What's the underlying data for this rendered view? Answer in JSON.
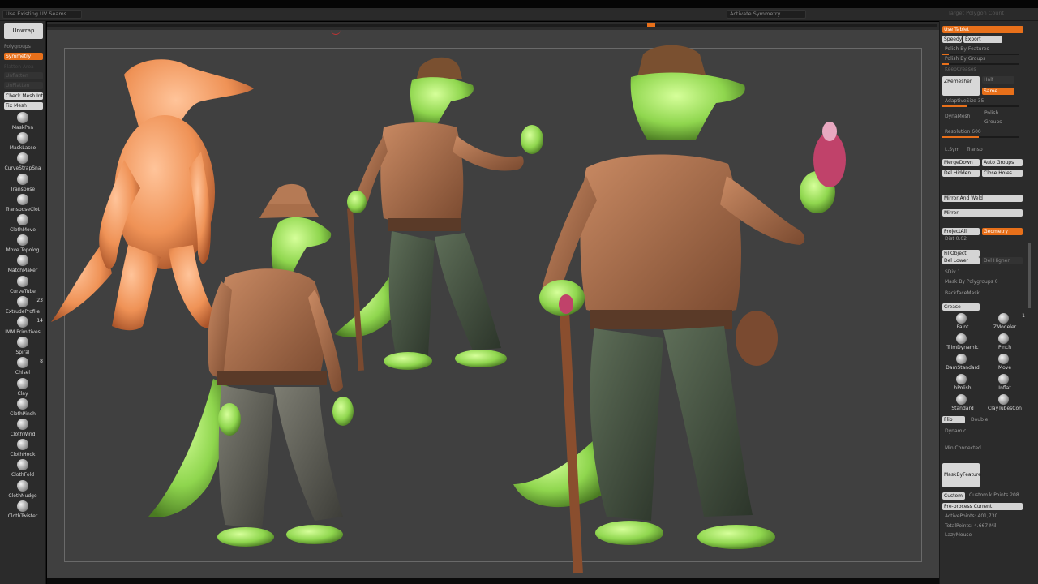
{
  "toolbar": {
    "uv_seams": "Use Existing UV Seams",
    "activate_symmetry": "Activate Symmetry",
    "target_polygons": "Target Polygon Count"
  },
  "left": {
    "unwrap": "Unwrap",
    "polygroups": "Polygroups",
    "symmetry": "Symmetry",
    "dim1": "Flatten Area",
    "dim2": "Unflatten",
    "dim3": "UnFlatten",
    "check_mesh": "Check Mesh Int",
    "fix_mesh": "Fix Mesh",
    "brushes": [
      {
        "name": "MaskPen",
        "num": ""
      },
      {
        "name": "MaskLasso",
        "num": ""
      },
      {
        "name": "CurveStrapSna",
        "num": ""
      },
      {
        "name": "Transpose",
        "num": ""
      },
      {
        "name": "TransposeClot",
        "num": ""
      },
      {
        "name": "ClothMove",
        "num": ""
      },
      {
        "name": "Move Topolog",
        "num": ""
      },
      {
        "name": "MatchMaker",
        "num": ""
      },
      {
        "name": "CurveTube",
        "num": ""
      },
      {
        "name": "ExtrudeProfile",
        "num": "23"
      },
      {
        "name": "IMM Primitives",
        "num": "14"
      },
      {
        "name": "Spiral",
        "num": ""
      },
      {
        "name": "Chisel",
        "num": "8"
      },
      {
        "name": "Clay",
        "num": ""
      },
      {
        "name": "ClothPinch",
        "num": ""
      },
      {
        "name": "ClothWind",
        "num": ""
      },
      {
        "name": "ClothHook",
        "num": ""
      },
      {
        "name": "ClothFold",
        "num": ""
      },
      {
        "name": "ClothNudge",
        "num": ""
      },
      {
        "name": "ClothTwister",
        "num": ""
      }
    ]
  },
  "right": {
    "use_tablet": "Use Tablet",
    "speedy": "Speedy",
    "export": "Export",
    "polish_features": "Polish By Features",
    "polish_groups": "Polish By Groups",
    "keep_creases": "KeepCreases",
    "zremesher": "ZRemesher",
    "half": "Half",
    "same": "Same",
    "adaptive_size": "AdaptiveSize 35",
    "dynamesh": "DynaMesh",
    "polish": "Polish",
    "groups": "Groups",
    "resolution": "Resolution 600",
    "lsym": "L.Sym",
    "transp": "Transp",
    "mergedown": "MergeDown",
    "auto_groups": "Auto Groups",
    "del_hidden": "Del Hidden",
    "close_holes": "Close Holes",
    "mirror_weld": "Mirror And Weld",
    "mirror": "Mirror",
    "projectall": "ProjectAll",
    "geometry": "Geometry",
    "dist": "Dist 0.02",
    "fillobject": "FillObject",
    "del_lower": "Del Lower",
    "del_higher": "Del Higher",
    "sdiv": "SDiv 1",
    "mask_polygroups": "Mask By Polygroups 0",
    "backface_mask": "BackfaceMask",
    "crease": "Crease",
    "brushes": [
      {
        "name": "Paint",
        "num": ""
      },
      {
        "name": "ZModeler",
        "num": "1"
      },
      {
        "name": "TrimDynamic",
        "num": ""
      },
      {
        "name": "Pinch",
        "num": ""
      },
      {
        "name": "DamStandard",
        "num": ""
      },
      {
        "name": "Move",
        "num": ""
      },
      {
        "name": "hPolish",
        "num": ""
      },
      {
        "name": "Inflat",
        "num": ""
      },
      {
        "name": "Standard",
        "num": ""
      },
      {
        "name": "ClayTubesCon",
        "num": ""
      }
    ],
    "flip": "Flip",
    "double": "Double",
    "dynamic": "Dynamic",
    "min_connected": "Min Connected",
    "mask_by_feature": "MaskByFeature",
    "custom": "Custom",
    "custom_points": "Custom k Points 208",
    "preprocess": "Pre-process Current",
    "active_points": "ActivePoints: 401,730",
    "total_points": "TotalPoints: 4.667 Mil",
    "lazymouse": "LazyMouse"
  },
  "colors": {
    "accent": "#e8701a",
    "panel": "#2b2b2b",
    "viewport": "#404040"
  }
}
